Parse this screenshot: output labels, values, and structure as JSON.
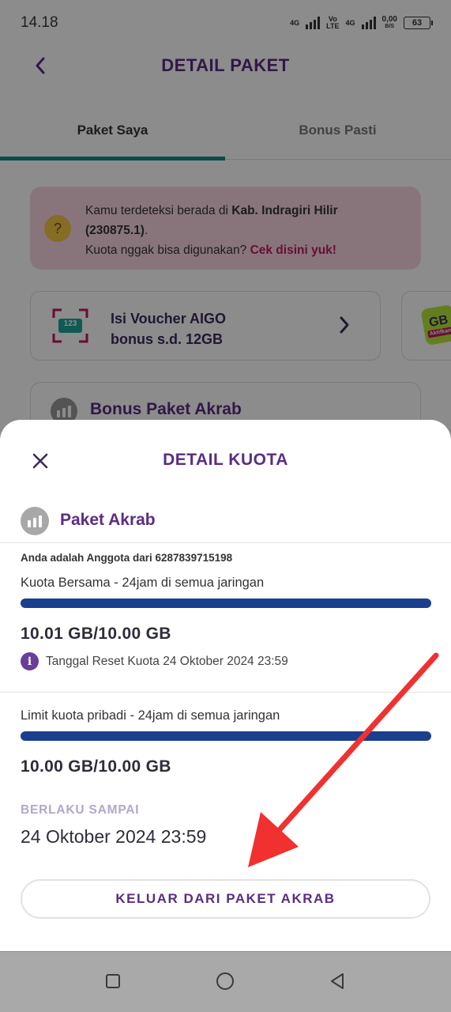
{
  "status_bar": {
    "time": "14.18",
    "net1": "4G",
    "net2": "Vo\nLTE",
    "net3": "4G",
    "speed": "0,00",
    "speed_unit": "B/S",
    "battery": "63"
  },
  "header": {
    "title": "DETAIL PAKET"
  },
  "tabs": [
    {
      "label": "Paket Saya",
      "active": true
    },
    {
      "label": "Bonus Pasti",
      "active": false
    }
  ],
  "location_notice": {
    "line1_prefix": "Kamu terdeteksi berada di ",
    "location": "Kab. Indragiri Hilir (230875.1)",
    "line1_suffix": ".",
    "line2_prefix": "Kuota nggak bisa digunakan? ",
    "link": "Cek disini yuk!"
  },
  "voucher": {
    "icon_text": "123",
    "line1": "Isi Voucher AIGO",
    "line2": "bonus s.d. 12GB"
  },
  "gb_promo": {
    "big": "GB",
    "small": "Aktifkan"
  },
  "bonus_card": {
    "title": "Bonus Paket Akrab"
  },
  "sheet": {
    "title": "DETAIL KUOTA",
    "package_name": "Paket Akrab",
    "member_text": "Anda adalah Anggota dari 6287839715198",
    "shared_label": "Kuota Bersama - 24jam di semua jaringan",
    "shared_value": "10.01 GB/10.00 GB",
    "shared_fraction": 1.0,
    "reset_text": "Tanggal Reset Kuota 24 Oktober 2024 23:59",
    "personal_label": "Limit kuota pribadi - 24jam di semua jaringan",
    "personal_value": "10.00 GB/10.00 GB",
    "personal_fraction": 1.0,
    "valid_label": "BERLAKU SAMPAI",
    "valid_date": "24 Oktober 2024 23:59",
    "exit_button": "KELUAR DARI PAKET AKRAB"
  },
  "colors": {
    "brand_purple": "#5a2d82",
    "progress_blue": "#1a3f8f",
    "tab_indicator": "#0d8f85",
    "annotation_arrow": "#f0312f"
  }
}
